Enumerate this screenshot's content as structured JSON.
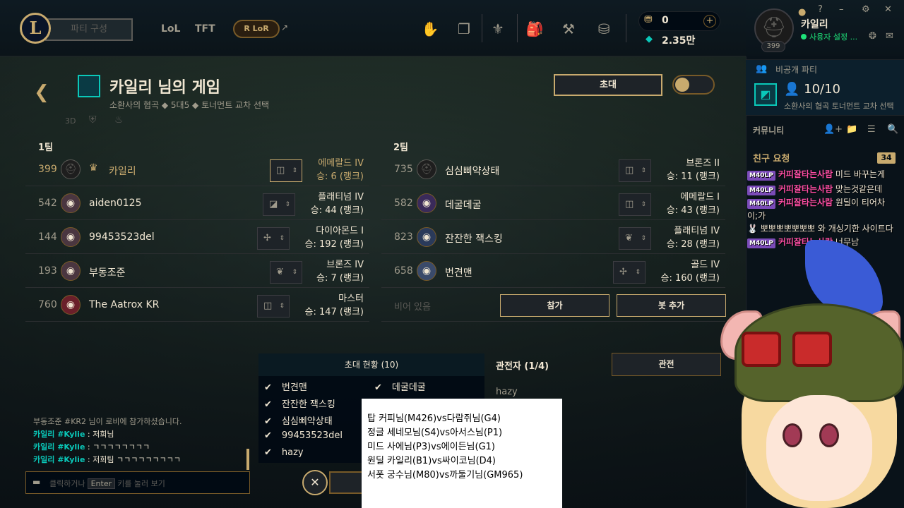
{
  "top": {
    "party_label": "파티 구성",
    "nav": [
      "LoL",
      "TFT"
    ],
    "lor": "LoR",
    "rp": "0",
    "be": "2.35만",
    "rp_plus": "+"
  },
  "profile": {
    "name": "카일리",
    "status": "사용자 설정 ...",
    "level": "399"
  },
  "private_party": {
    "label": "비공개 파티",
    "count": "10/10",
    "sub": "소환사의 협곡 토너먼트 교차 선택"
  },
  "community": {
    "label": "커뮤니티",
    "friend_requests": "친구 요청",
    "badge": "34"
  },
  "overlay_chat": [
    {
      "badge": "40LP",
      "name": "커피잘타는사람",
      "text": " 미드 바꾸는게"
    },
    {
      "badge": "40LP",
      "name": "커피잘타는사람",
      "text": " 맞는것같은데"
    },
    {
      "badge": "40LP",
      "name": "커피잘타는사람",
      "text": " 원딜이 티어차"
    },
    {
      "badge": "",
      "name": "",
      "text": "이;가"
    },
    {
      "badge": "",
      "name": "",
      "text": "🐰 뽀뽀뽀뽀뽀뽀뽀 와 개싱기한 사이트다"
    },
    {
      "badge": "40LP",
      "name": "커피잘타는사람",
      "text": " 너무남"
    }
  ],
  "lobby": {
    "title": "카일리 님의 게임",
    "sub": "소환사의 협곡  ◆  5대5  ◆  토너먼트 교차 선택",
    "invite": "초대",
    "mini": [
      "3D",
      "⛨",
      "♨"
    ]
  },
  "team1": {
    "label": "1팀",
    "players": [
      {
        "level": "399",
        "name": "카일리",
        "rank": "에메랄드 IV",
        "games": "승: 6 (랭크)",
        "highlight": true,
        "pos": "◫"
      },
      {
        "level": "542",
        "name": "aiden0125",
        "rank": "플래티넘 IV",
        "games": "승: 44 (랭크)",
        "pos": "◪"
      },
      {
        "level": "144",
        "name": "99453523del",
        "rank": "다이아몬드 I",
        "games": "승: 192 (랭크)",
        "pos": "✢"
      },
      {
        "level": "193",
        "name": "부동조준",
        "rank": "브론즈 IV",
        "games": "승: 7 (랭크)",
        "pos": "❦"
      },
      {
        "level": "760",
        "name": "The Aatrox KR",
        "rank": "마스터",
        "games": "승: 147 (랭크)",
        "pos": "◫"
      }
    ]
  },
  "team2": {
    "label": "2팀",
    "players": [
      {
        "level": "735",
        "name": "심심삐약상태",
        "rank": "브론즈 II",
        "games": "승: 11 (랭크)",
        "pos": "◫"
      },
      {
        "level": "582",
        "name": "데굴데굴",
        "rank": "에메랄드 I",
        "games": "승: 43 (랭크)",
        "pos": "◫"
      },
      {
        "level": "823",
        "name": "잔잔한 잭스킹",
        "rank": "플래티넘 IV",
        "games": "승: 28 (랭크)",
        "pos": "❦"
      },
      {
        "level": "658",
        "name": "번견맨",
        "rank": "골드 IV",
        "games": "승: 160 (랭크)",
        "pos": "✢"
      }
    ],
    "empty": "비어 있음",
    "join": "참가",
    "add_bot": "봇 추가"
  },
  "invites": {
    "header": "초대 현황 (10)",
    "left": [
      "번견맨",
      "잔잔한 잭스킹",
      "심심삐약상태",
      "99453523del",
      "hazy"
    ],
    "right": [
      "데굴데굴"
    ]
  },
  "spectators": {
    "label": "관전자 (1/4)",
    "button": "관전",
    "names": [
      "hazy"
    ]
  },
  "chat": {
    "lines": [
      {
        "name": "",
        "text": "부동조준 #KR2 님이 로비에 참가하셨습니다."
      },
      {
        "name": "카일리 #Kylie",
        "text": " : 저희님"
      },
      {
        "name": "카일리 #Kylie",
        "text": " : ㄱㄱㄱㄱㄱㄱㄱㄱ"
      },
      {
        "name": "카일리 #Kylie",
        "text": " : 저희팀 ㄱㄱㄱㄱㄱㄱㄱㄱㄱ"
      }
    ],
    "ph_before": "클릭하거나",
    "ph_key": "Enter",
    "ph_after": "키를 눌러 보기"
  },
  "note": [
    "탑 커피님(M426)vs다람쥐님(G4)",
    "정글 세네모님(S4)vs아서스님(P1)",
    "미드 사에님(P3)vs에이든님(G1)",
    "원딜 카일리(B1)vs싸이코님(D4)",
    "서폿 궁수님(M80)vs까둘기님(GM965)"
  ]
}
